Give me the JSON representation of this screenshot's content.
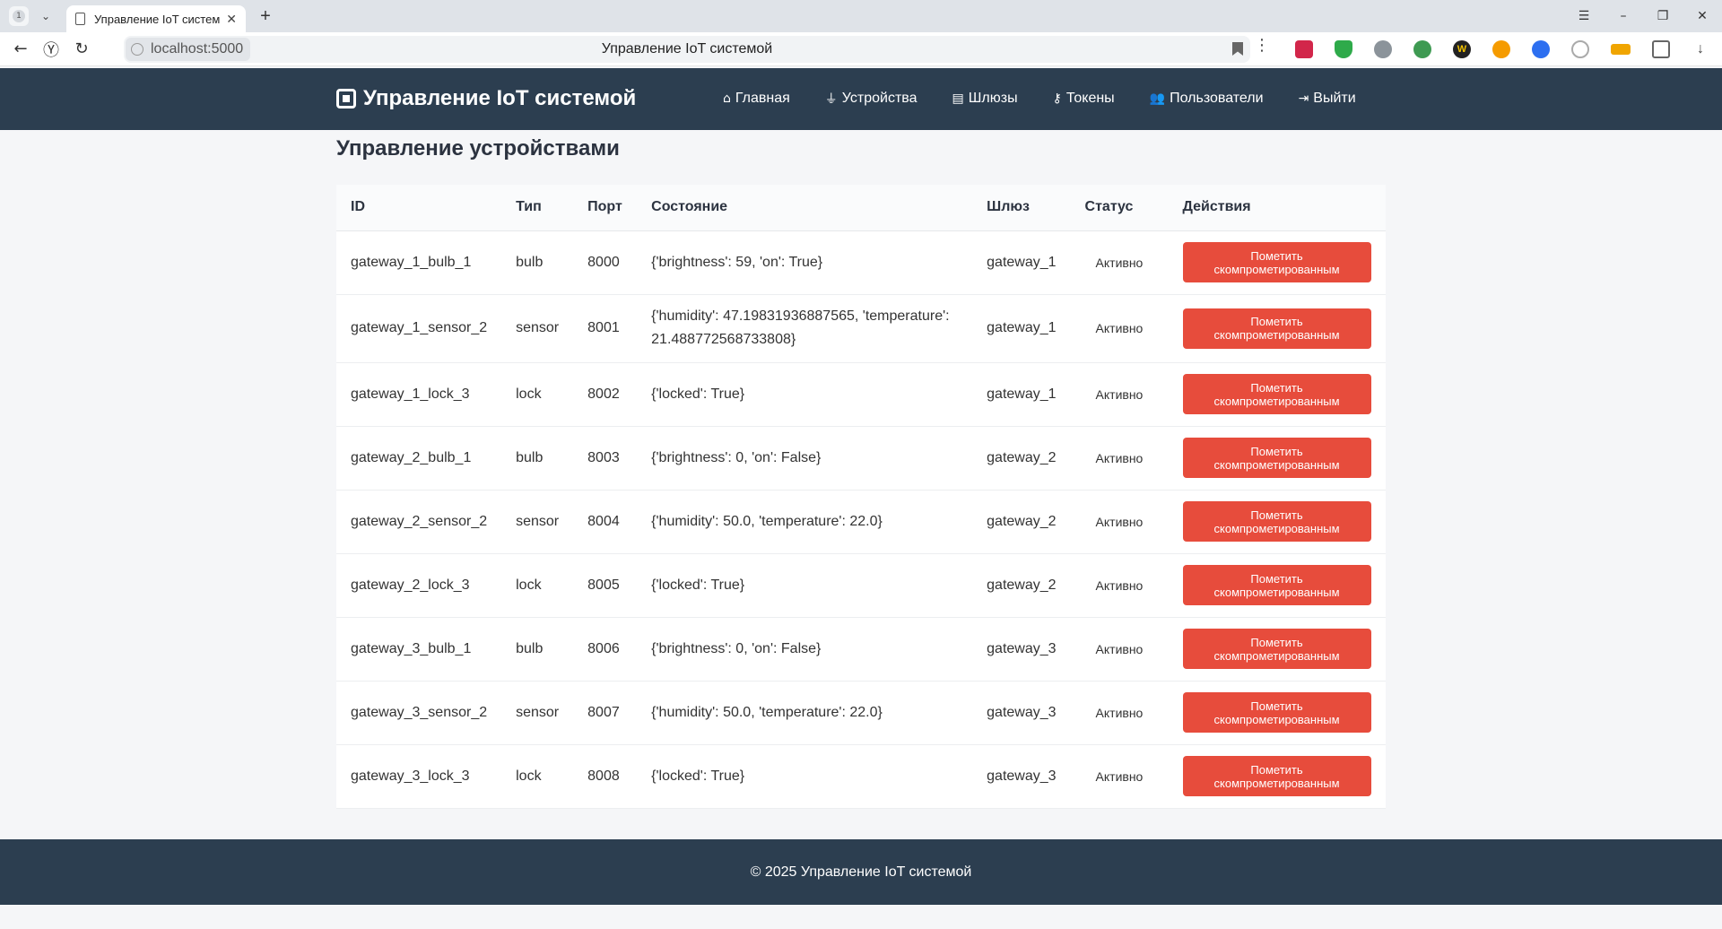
{
  "browser": {
    "tab_count": "1",
    "tab_title": "Управление IoT систем",
    "url": "localhost:5000",
    "page_title": "Управление IoT системой"
  },
  "app": {
    "brand": "Управление IoT системой",
    "nav": [
      {
        "label": "Главная",
        "icon": "home-icon"
      },
      {
        "label": "Устройства",
        "icon": "plug-icon"
      },
      {
        "label": "Шлюзы",
        "icon": "server-icon"
      },
      {
        "label": "Токены",
        "icon": "key-icon"
      },
      {
        "label": "Пользователи",
        "icon": "users-icon"
      },
      {
        "label": "Выйти",
        "icon": "sign-out-icon"
      }
    ],
    "heading": "Управление устройствами",
    "columns": [
      "ID",
      "Тип",
      "Порт",
      "Состояние",
      "Шлюз",
      "Статус",
      "Действия"
    ],
    "rows": [
      {
        "id": "gateway_1_bulb_1",
        "type": "bulb",
        "port": "8000",
        "state": "{'brightness': 59, 'on': True}",
        "gateway": "gateway_1",
        "status": "Активно",
        "action": "Пометить скомпрометированным"
      },
      {
        "id": "gateway_1_sensor_2",
        "type": "sensor",
        "port": "8001",
        "state": "{'humidity': 47.19831936887565, 'temperature': 21.488772568733808}",
        "gateway": "gateway_1",
        "status": "Активно",
        "action": "Пометить скомпрометированным"
      },
      {
        "id": "gateway_1_lock_3",
        "type": "lock",
        "port": "8002",
        "state": "{'locked': True}",
        "gateway": "gateway_1",
        "status": "Активно",
        "action": "Пометить скомпрометированным"
      },
      {
        "id": "gateway_2_bulb_1",
        "type": "bulb",
        "port": "8003",
        "state": "{'brightness': 0, 'on': False}",
        "gateway": "gateway_2",
        "status": "Активно",
        "action": "Пометить скомпрометированным"
      },
      {
        "id": "gateway_2_sensor_2",
        "type": "sensor",
        "port": "8004",
        "state": "{'humidity': 50.0, 'temperature': 22.0}",
        "gateway": "gateway_2",
        "status": "Активно",
        "action": "Пометить скомпрометированным"
      },
      {
        "id": "gateway_2_lock_3",
        "type": "lock",
        "port": "8005",
        "state": "{'locked': True}",
        "gateway": "gateway_2",
        "status": "Активно",
        "action": "Пометить скомпрометированным"
      },
      {
        "id": "gateway_3_bulb_1",
        "type": "bulb",
        "port": "8006",
        "state": "{'brightness': 0, 'on': False}",
        "gateway": "gateway_3",
        "status": "Активно",
        "action": "Пометить скомпрометированным"
      },
      {
        "id": "gateway_3_sensor_2",
        "type": "sensor",
        "port": "8007",
        "state": "{'humidity': 50.0, 'temperature': 22.0}",
        "gateway": "gateway_3",
        "status": "Активно",
        "action": "Пометить скомпрометированным"
      },
      {
        "id": "gateway_3_lock_3",
        "type": "lock",
        "port": "8008",
        "state": "{'locked': True}",
        "gateway": "gateway_3",
        "status": "Активно",
        "action": "Пометить скомпрометированным"
      }
    ],
    "footer": "© 2025 Управление IoT системой"
  },
  "colors": {
    "header_bg": "#2c3e50",
    "danger": "#e74c3c",
    "page_bg": "#f5f6f8"
  }
}
